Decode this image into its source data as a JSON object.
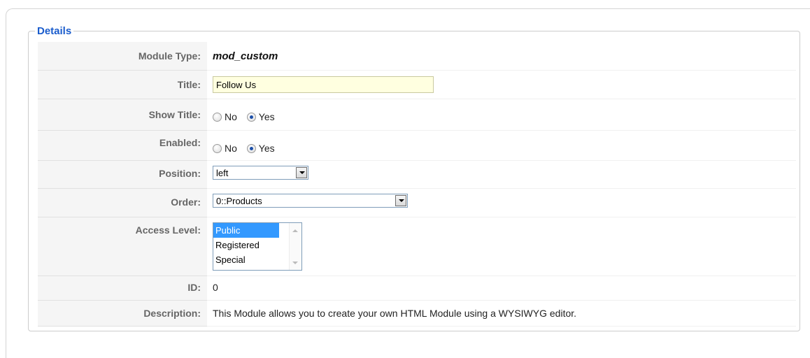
{
  "fieldset": {
    "legend": "Details"
  },
  "rows": {
    "module_type": {
      "label": "Module Type:",
      "value": "mod_custom"
    },
    "title": {
      "label": "Title:",
      "value": "Follow Us"
    },
    "show_title": {
      "label": "Show Title:",
      "options": [
        "No",
        "Yes"
      ],
      "selected": "Yes"
    },
    "enabled": {
      "label": "Enabled:",
      "options": [
        "No",
        "Yes"
      ],
      "selected": "Yes"
    },
    "position": {
      "label": "Position:",
      "selected": "left"
    },
    "order": {
      "label": "Order:",
      "selected": "0::Products"
    },
    "access_level": {
      "label": "Access Level:",
      "options": [
        "Public",
        "Registered",
        "Special"
      ],
      "selected": "Public"
    },
    "id": {
      "label": "ID:",
      "value": "0"
    },
    "description": {
      "label": "Description:",
      "value": "This Module allows you to create your own HTML Module using a WYSIWYG editor."
    }
  },
  "colors": {
    "legend": "#1a5ccc",
    "title_input_bg": "#ffffe0",
    "selected_option_bg": "#3399ff"
  }
}
